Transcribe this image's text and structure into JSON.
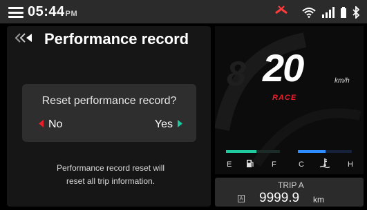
{
  "status_bar": {
    "time": "05:44",
    "ampm": "PM",
    "icons": [
      "menu-icon",
      "alert-icon",
      "wifi-icon",
      "signal-icon",
      "battery-icon",
      "bluetooth-icon"
    ]
  },
  "screen": {
    "title": "Performance record",
    "dialog": {
      "question": "Reset performance record?",
      "no_label": "No",
      "yes_label": "Yes"
    },
    "info_text": [
      "Performance record reset will",
      "reset all trip information."
    ]
  },
  "dashboard": {
    "speed": "20",
    "speed_unit": "km/h",
    "mode": "RACE",
    "fuel_gauge": {
      "empty_label": "E",
      "full_label": "F",
      "color": "#1fc9a0"
    },
    "temp_gauge": {
      "cold_label": "C",
      "hot_label": "H",
      "color": "#2f8cff"
    },
    "trip": {
      "name": "TRIP A",
      "badge": "A",
      "value": "9999.9",
      "unit": "km"
    }
  },
  "colors": {
    "accent_red": "#e8202a",
    "panel": "#161616",
    "dialog": "#2e2e2e"
  }
}
